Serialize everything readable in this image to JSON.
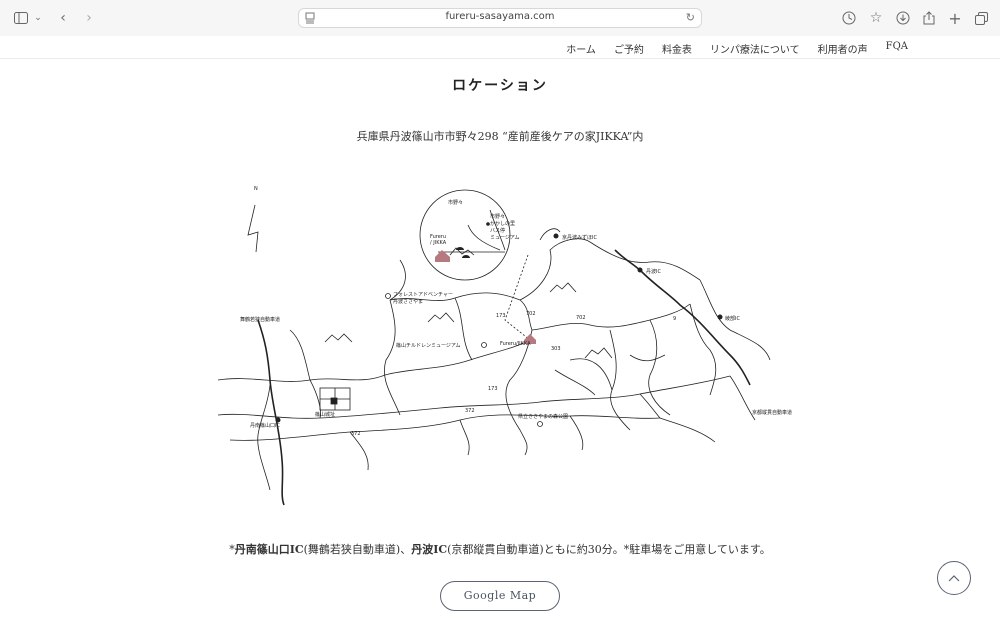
{
  "browser": {
    "url": "fureru-sasayama.com"
  },
  "nav": {
    "items": [
      "ホーム",
      "ご予約",
      "料金表",
      "リンパ療法について",
      "利用者の声",
      "FQA"
    ]
  },
  "section": {
    "title": "ロケーション",
    "address": "兵庫県丹波篠山市市野々298 “産前産後ケアの家JIKKA”内"
  },
  "map": {
    "compass": "N",
    "inset_labels": {
      "ichinono": "市野々",
      "kakashi1": "市野々",
      "kakashi2": "かかしの里",
      "kakashi3": "バス停",
      "kakashi4": "ミュージアム",
      "fureru1": "Fureru",
      "fureru2": "/ JIKKA"
    },
    "labels": {
      "tamba_ic_n": "京丹波みずほIC",
      "tamba_ic": "丹波IC",
      "ayabe_ic": "綾部IC",
      "maizuru_exp": "舞鶴若狭自動車道",
      "kyoto_exp": "京都縦貫自動車道",
      "forest1": "フォレストアドベンチャー",
      "forest2": "丹波ささやま",
      "children_museum": "篠山チルドレンミュージアム",
      "fureru": "Fureru/JIKKA",
      "castle": "篠山城址",
      "sasayama_ic": "丹南篠山口IC",
      "park": "県立ささやまの森公園",
      "r173a": "173",
      "r173b": "173",
      "r702a": "702",
      "r702b": "702",
      "r303": "303",
      "r372a": "372",
      "r372b": "372",
      "r9": "9"
    }
  },
  "access": {
    "star1": "*",
    "ic1": "丹南篠山口IC",
    "exp1": "(舞鶴若狭自動車道)、",
    "ic2": "丹波IC",
    "exp2": "(京都縦貫自動車道)ともに約30分。*駐車場をご用意しています。"
  },
  "buttons": {
    "google_map": "Google Map"
  }
}
